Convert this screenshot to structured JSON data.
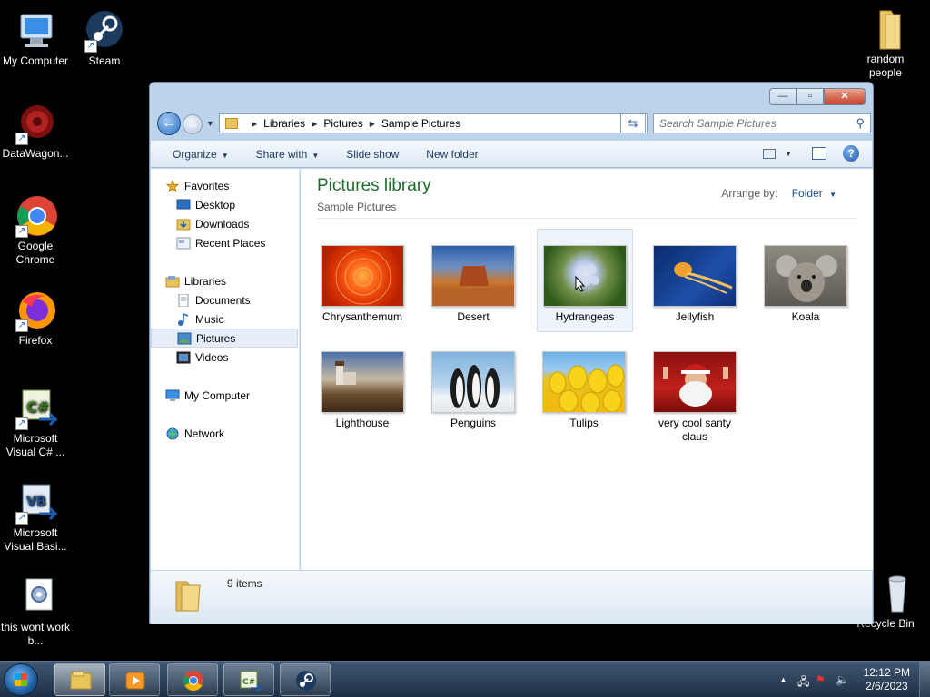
{
  "desktop": {
    "icons": [
      {
        "label": "My Computer"
      },
      {
        "label": "Steam"
      },
      {
        "label": "DataWagon..."
      },
      {
        "label": "Google Chrome"
      },
      {
        "label": "Firefox"
      },
      {
        "label": "Microsoft Visual C# ..."
      },
      {
        "label": "Microsoft Visual Basi..."
      },
      {
        "label": "this wont work b..."
      },
      {
        "label": "random people"
      },
      {
        "label": "Recycle Bin"
      }
    ]
  },
  "window": {
    "caption": {
      "minimize": "—",
      "maximize": "▫",
      "close": "✕"
    },
    "address": {
      "crumbs": [
        "Libraries",
        "Pictures",
        "Sample Pictures"
      ]
    },
    "search": {
      "placeholder": "Search Sample Pictures"
    },
    "toolbar": {
      "organize": "Organize",
      "share_with": "Share with",
      "slide_show": "Slide show",
      "new_folder": "New folder"
    },
    "nav": {
      "favorites": "Favorites",
      "desktop": "Desktop",
      "downloads": "Downloads",
      "recent_places": "Recent Places",
      "libraries": "Libraries",
      "documents": "Documents",
      "music": "Music",
      "pictures": "Pictures",
      "videos": "Videos",
      "my_computer": "My Computer",
      "network": "Network"
    },
    "content": {
      "title": "Pictures library",
      "subtitle": "Sample Pictures",
      "arrange_by_label": "Arrange by:",
      "arrange_by_value": "Folder",
      "items": [
        {
          "name": "Chrysanthemum"
        },
        {
          "name": "Desert"
        },
        {
          "name": "Hydrangeas"
        },
        {
          "name": "Jellyfish"
        },
        {
          "name": "Koala"
        },
        {
          "name": "Lighthouse"
        },
        {
          "name": "Penguins"
        },
        {
          "name": "Tulips"
        },
        {
          "name": "very cool santy claus"
        }
      ]
    },
    "details": {
      "count": "9 items"
    }
  },
  "taskbar": {
    "apps": [
      {
        "icon": "explorer-icon"
      },
      {
        "icon": "media-player-icon"
      },
      {
        "icon": "chrome-icon"
      },
      {
        "icon": "visual-csharp-icon"
      },
      {
        "icon": "steam-icon"
      }
    ],
    "clock": {
      "time": "12:12 PM",
      "date": "2/6/2023"
    }
  }
}
